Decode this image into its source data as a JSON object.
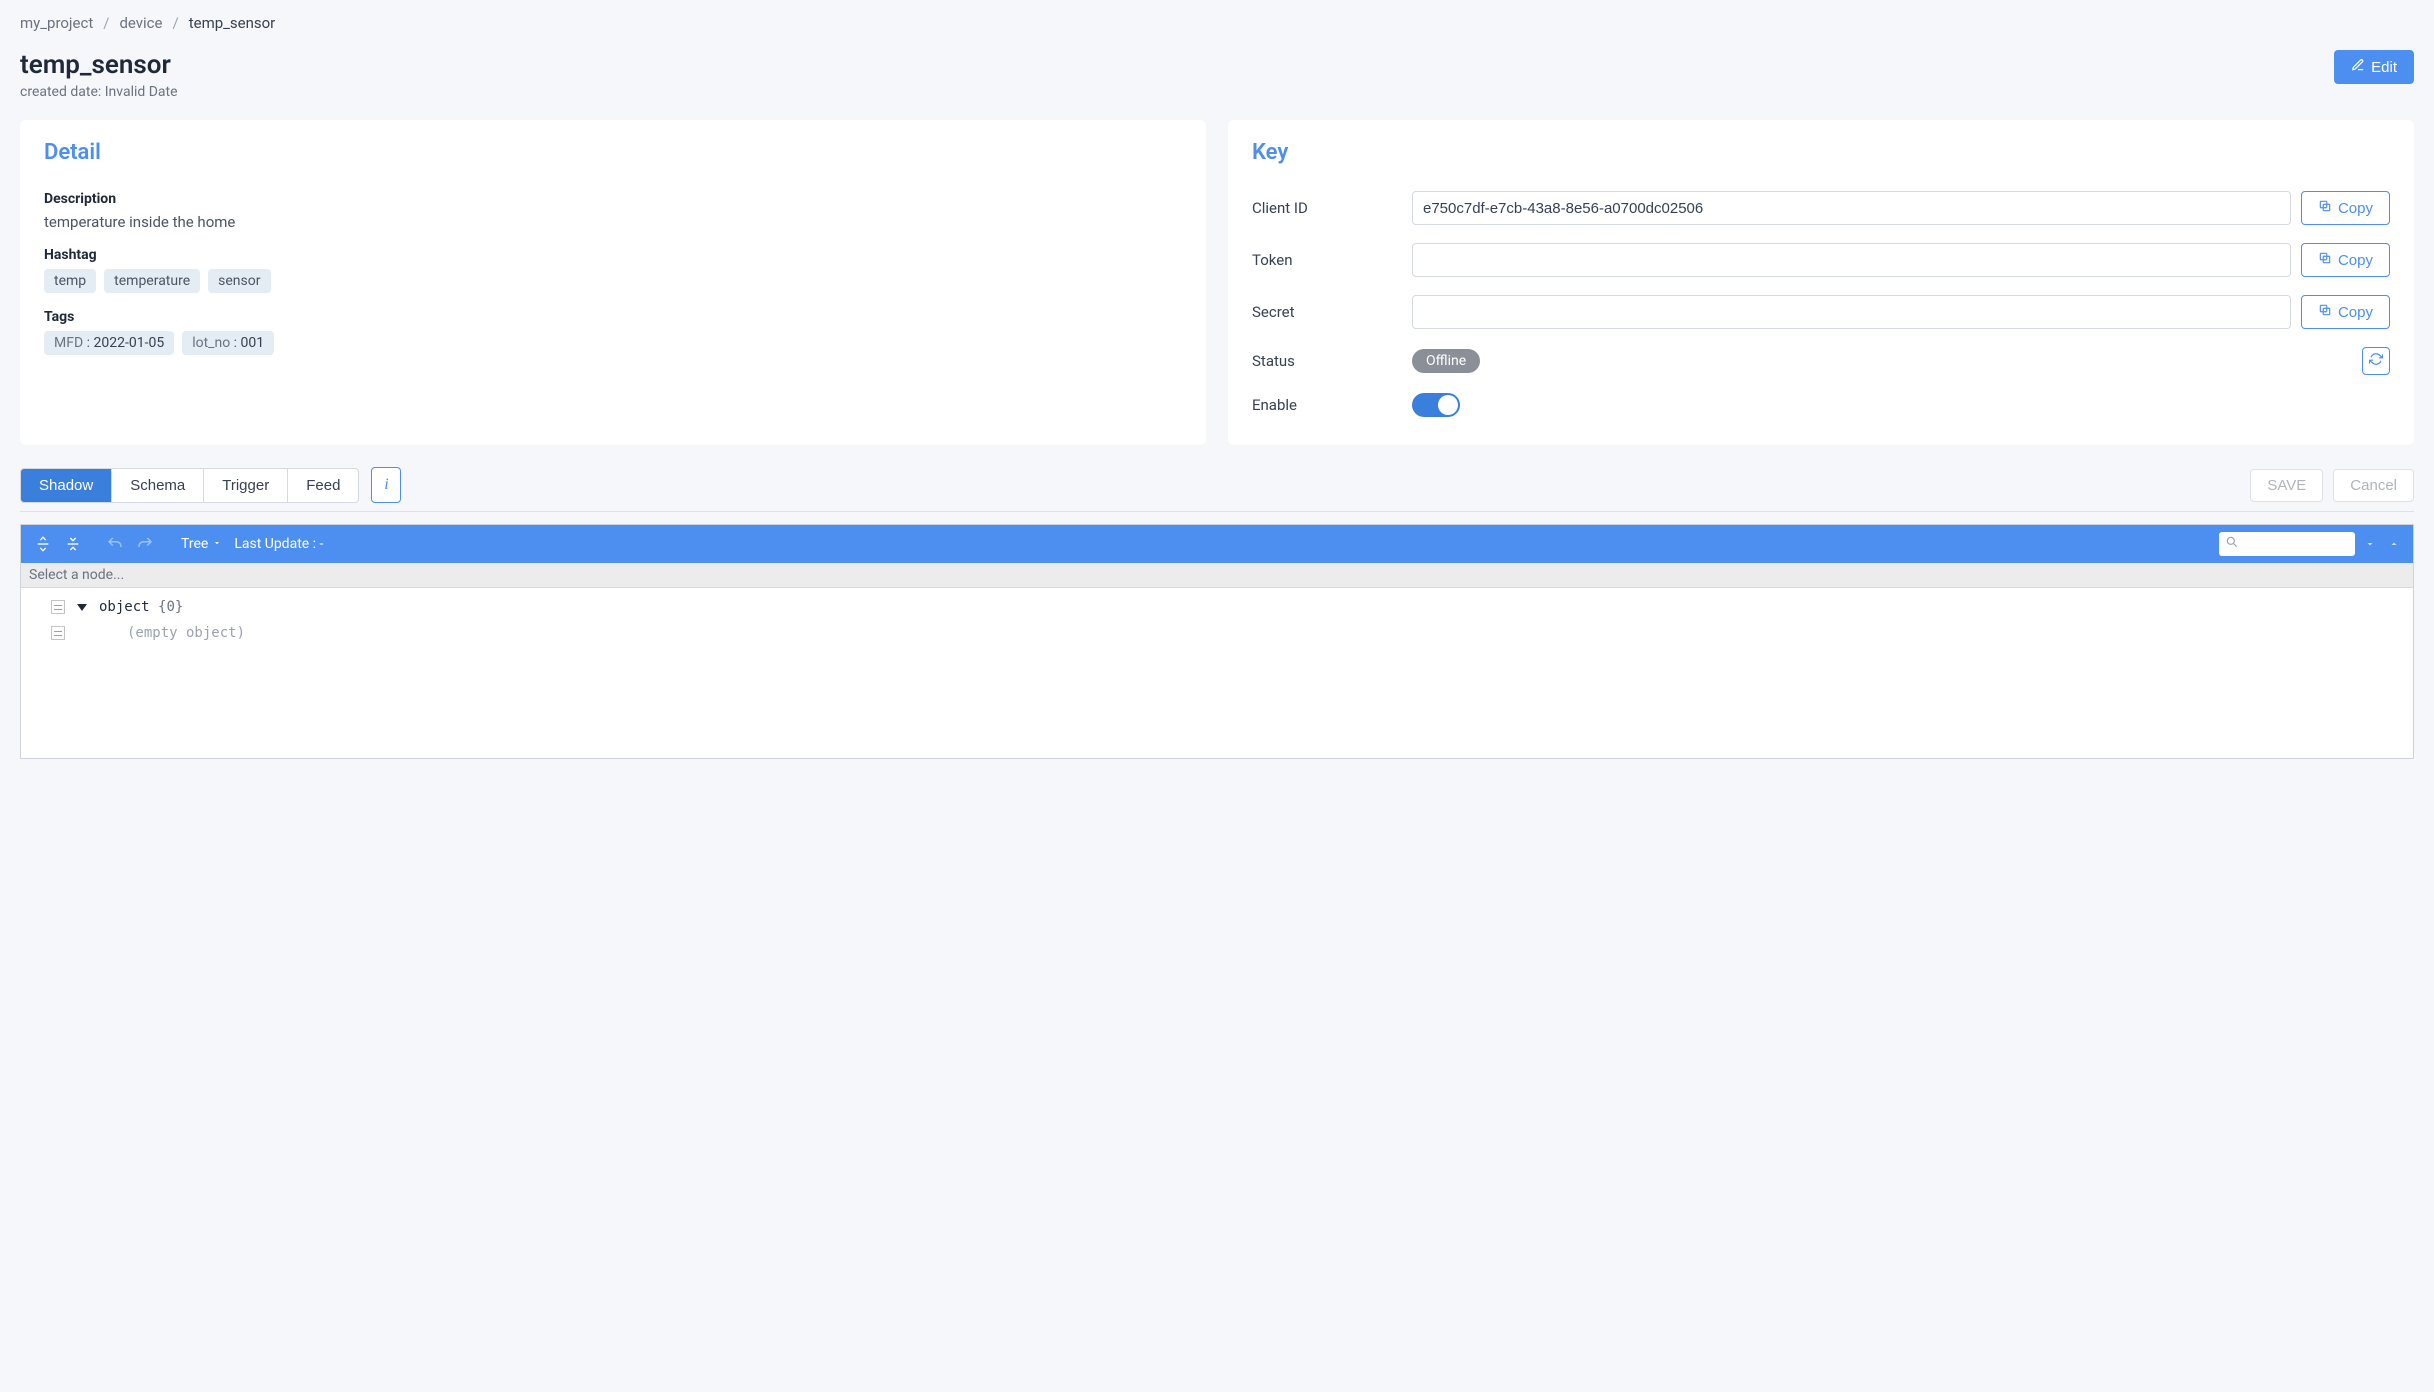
{
  "breadcrumb": {
    "items": [
      {
        "label": "my_project"
      },
      {
        "label": "device"
      }
    ],
    "current": "temp_sensor"
  },
  "header": {
    "title": "temp_sensor",
    "created_label": "created date: Invalid Date",
    "edit_label": "Edit"
  },
  "detail": {
    "heading": "Detail",
    "description_label": "Description",
    "description_value": "temperature inside the home",
    "hashtag_label": "Hashtag",
    "hashtags": [
      "temp",
      "temperature",
      "sensor"
    ],
    "tags_label": "Tags",
    "tags": [
      {
        "key": "MFD",
        "value": "2022-01-05"
      },
      {
        "key": "lot_no",
        "value": "001"
      }
    ]
  },
  "key": {
    "heading": "Key",
    "client_id_label": "Client ID",
    "client_id_value": "e750c7df-e7cb-43a8-8e56-a0700dc02506",
    "token_label": "Token",
    "token_value": "",
    "secret_label": "Secret",
    "secret_value": "",
    "copy_label": "Copy",
    "status_label": "Status",
    "status_value": "Offline",
    "enable_label": "Enable",
    "enable_value": true
  },
  "tabs": {
    "items": [
      "Shadow",
      "Schema",
      "Trigger",
      "Feed"
    ],
    "active_index": 0,
    "save_label": "SAVE",
    "cancel_label": "Cancel"
  },
  "editor": {
    "mode_label": "Tree",
    "last_update_label": "Last Update : -",
    "path_placeholder": "Select a node...",
    "root_label": "object",
    "root_count": "{0}",
    "empty_label": "(empty object)"
  }
}
